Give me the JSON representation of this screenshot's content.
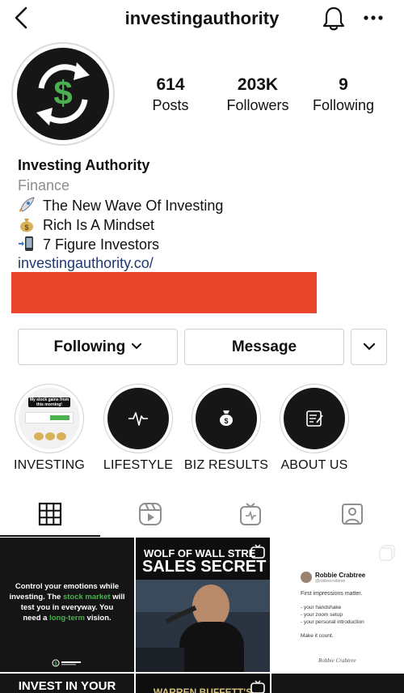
{
  "header": {
    "username": "investingauthority",
    "icons": [
      "back-arrow-icon",
      "bell-icon",
      "more-dots-icon"
    ]
  },
  "profile": {
    "avatar_symbol": "$",
    "stats": [
      {
        "value": "614",
        "label": "Posts"
      },
      {
        "value": "203K",
        "label": "Followers"
      },
      {
        "value": "9",
        "label": "Following"
      }
    ],
    "name": "Investing Authority",
    "category": "Finance",
    "bio_lines": [
      {
        "emoji": "rocket-icon",
        "text": "The New Wave Of Investing"
      },
      {
        "emoji": "money-bag-icon",
        "text": "Rich Is A Mindset"
      },
      {
        "emoji": "phone-icon",
        "text": "7 Figure Investors"
      }
    ],
    "link": "investingauthority.co/",
    "redaction_color": "#e8442a"
  },
  "actions": {
    "following_label": "Following",
    "message_label": "Message"
  },
  "highlights": [
    {
      "label": "INVESTING",
      "preview_title": "My stock gains from this morning!"
    },
    {
      "label": "LIFESTYLE"
    },
    {
      "label": "BIZ RESULTS"
    },
    {
      "label": "ABOUT US"
    }
  ],
  "tabs": [
    "grid-icon",
    "reels-icon",
    "igtv-icon",
    "tagged-icon"
  ],
  "posts": [
    {
      "line1": "Control your emotions while",
      "line2a": "investing. The ",
      "line2b": "stock market",
      "line2c": " will",
      "line3": "test you in everyway. You",
      "line4a": "need a ",
      "line4b": "long-term",
      "line4c": " vision."
    },
    {
      "title1": "WOLF OF WALL STRE",
      "title2": "SALES SECRET"
    },
    {
      "author": "Robbie Crabtree",
      "handle": "@robbiecrabtree",
      "heading": "First impressions matter.",
      "items": [
        "- your handshake",
        "- your zoom setup",
        "- your personal introduction"
      ],
      "closing": "Make it count.",
      "signature": "Robbie Crabtree"
    },
    {
      "title": "INVEST IN YOUR"
    },
    {
      "title": "WARREN BUFFETT'S"
    },
    {
      "title": ""
    }
  ],
  "colors": {
    "accent_green": "#4caf50",
    "link": "#1d3a70",
    "muted": "#8e8e8e"
  }
}
